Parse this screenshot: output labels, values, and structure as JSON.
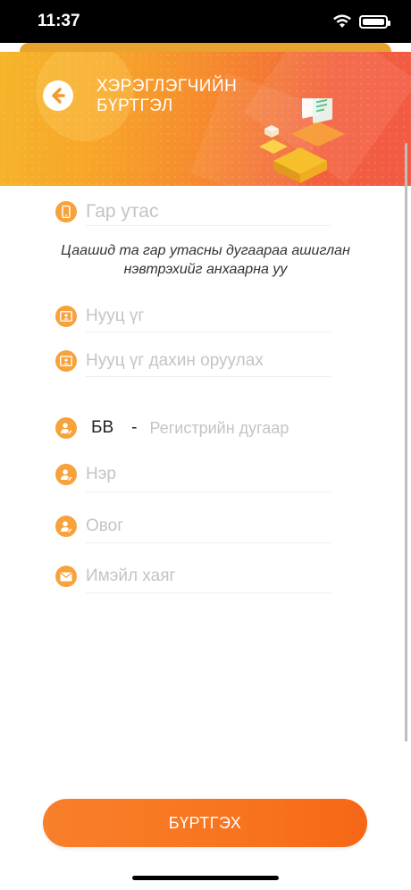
{
  "status_bar": {
    "time": "11:37"
  },
  "header": {
    "title_line1": "ХЭРЭГЛЭГЧИЙН",
    "title_line2": "БҮРТГЭЛ"
  },
  "form": {
    "phone": {
      "placeholder": "Гар утас",
      "hint_line1": "Цаашид та гар утасны дугаараа ашиглан",
      "hint_line2": "нэвтрэхийг анхаарна уу"
    },
    "password": {
      "placeholder": "Нууц үг"
    },
    "password_repeat": {
      "placeholder": "Нууц үг дахин оруулах"
    },
    "register_id": {
      "prefix": "БВ",
      "separator": "-",
      "placeholder": "Регистрийн дугаар"
    },
    "first_name": {
      "placeholder": "Нэр"
    },
    "last_name": {
      "placeholder": "Овог"
    },
    "email": {
      "placeholder": "Имэйл хаяг"
    }
  },
  "submit": {
    "label": "БҮРТГЭХ"
  },
  "colors": {
    "accent": "#f7a23a",
    "button": "#f8741f"
  }
}
